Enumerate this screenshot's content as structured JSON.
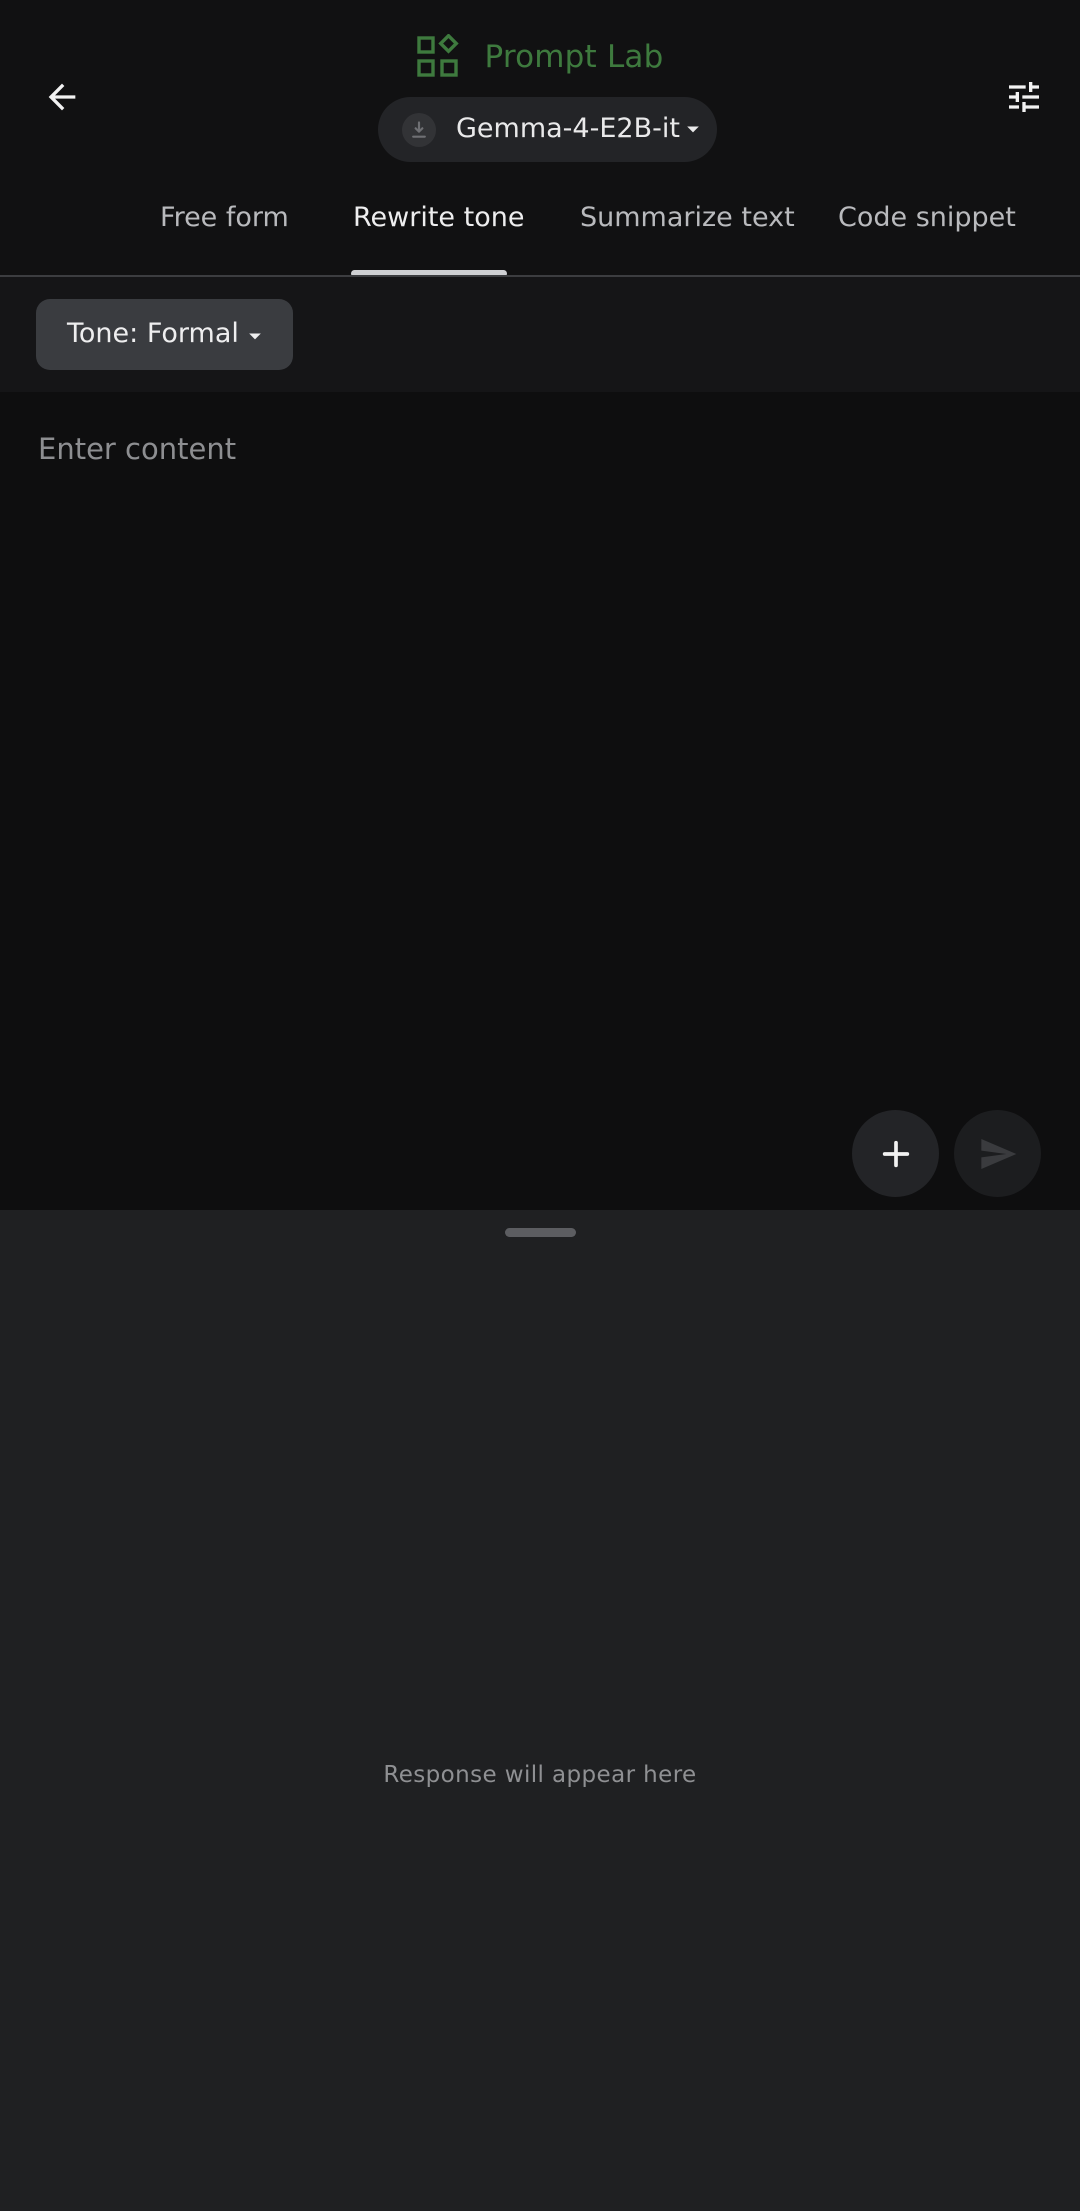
{
  "app": {
    "title": "Prompt Lab",
    "accent_color": "#3e7a3e",
    "title_icon": "widgets-icon"
  },
  "header": {
    "back_icon": "arrow-back-icon",
    "settings_icon": "tune-icon",
    "model_selector": {
      "status_icon": "download-icon",
      "model_name": "Gemma-4-E2B-it",
      "dropdown_icon": "caret-down-icon"
    }
  },
  "tabs": [
    {
      "label": "Free form",
      "active": false
    },
    {
      "label": "Rewrite tone",
      "active": true
    },
    {
      "label": "Summarize text",
      "active": false
    },
    {
      "label": "Code snippet",
      "active": false
    }
  ],
  "tone_selector": {
    "label": "Tone: Formal",
    "dropdown_icon": "caret-down-icon"
  },
  "input": {
    "value": "",
    "placeholder": "Enter content",
    "add_icon": "plus-icon",
    "send_icon": "send-icon"
  },
  "response": {
    "placeholder": "Response will appear here"
  }
}
